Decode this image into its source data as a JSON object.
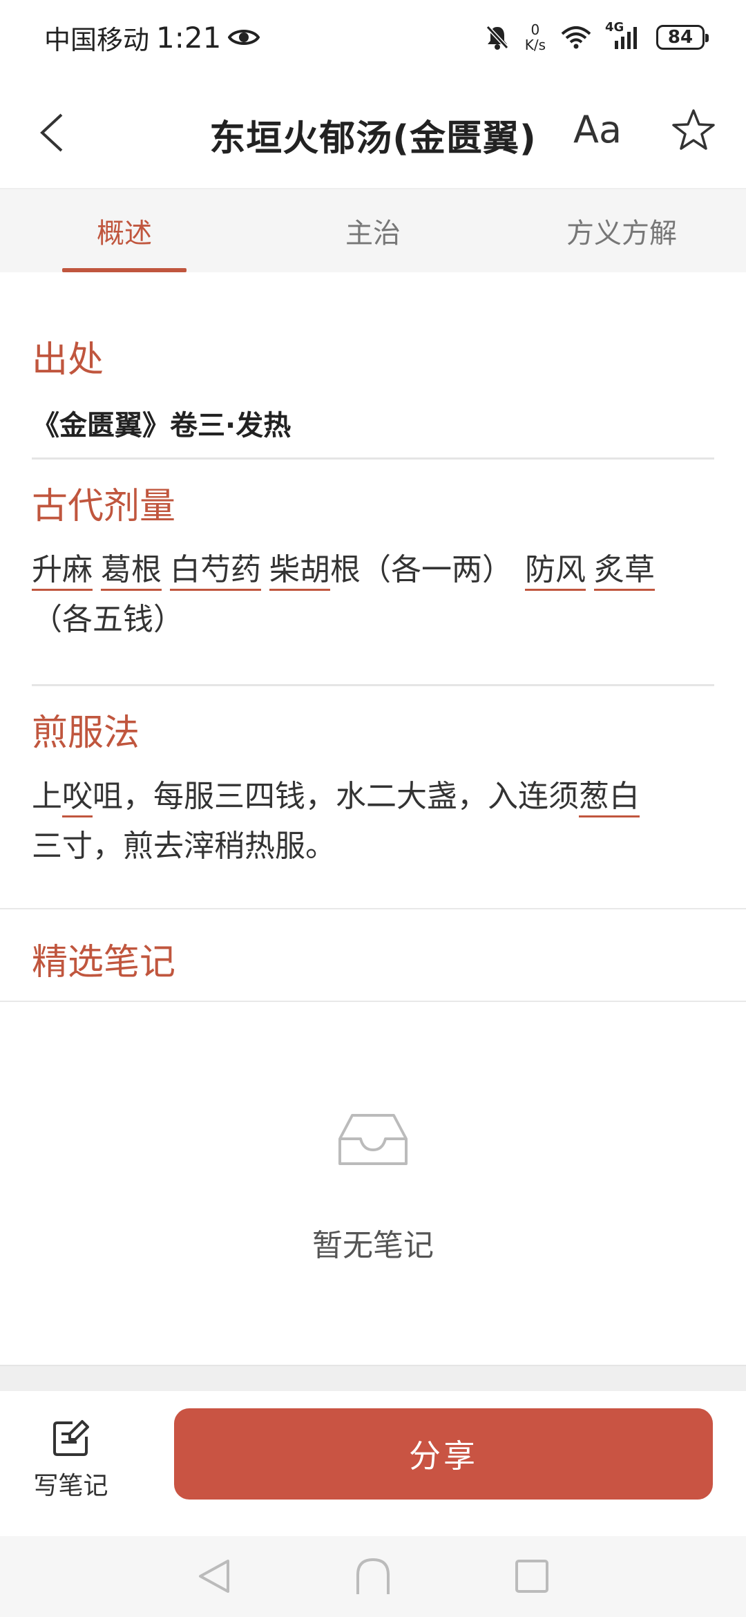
{
  "status": {
    "carrier": "中国移动",
    "time": "1:21",
    "net_speed_value": "0",
    "net_speed_unit": "K/s",
    "network": "4G",
    "battery": "84"
  },
  "header": {
    "title": "东垣火郁汤(金匮翼)",
    "font_label": "Aa"
  },
  "tabs": [
    {
      "label": "概述",
      "active": true
    },
    {
      "label": "主治",
      "active": false
    },
    {
      "label": "方义方解",
      "active": false
    }
  ],
  "source": {
    "title": "出处",
    "text": "《金匮翼》卷三·发热"
  },
  "dosage": {
    "title": "古代剂量",
    "herbs1": [
      "升麻",
      "葛根",
      "白芍药"
    ],
    "herb_chaihu": "柴胡",
    "chaihu_suffix": "根（各一两）",
    "herbs2": [
      "防风",
      "炙草"
    ],
    "tail": "（各五钱）"
  },
  "decoction": {
    "title": "煎服法",
    "p1": "上",
    "u1": "㕮",
    "p2": "咀，每服三四钱，水二大盏，入连须",
    "u2": "葱白",
    "p3": "三寸，煎去滓稍热服。"
  },
  "notes": {
    "title": "精选笔记",
    "empty_text": "暂无笔记"
  },
  "bottom": {
    "write_note_label": "写笔记",
    "share_label": "分享"
  },
  "colors": {
    "accent": "#c0563e",
    "share_button": "#c95443"
  }
}
